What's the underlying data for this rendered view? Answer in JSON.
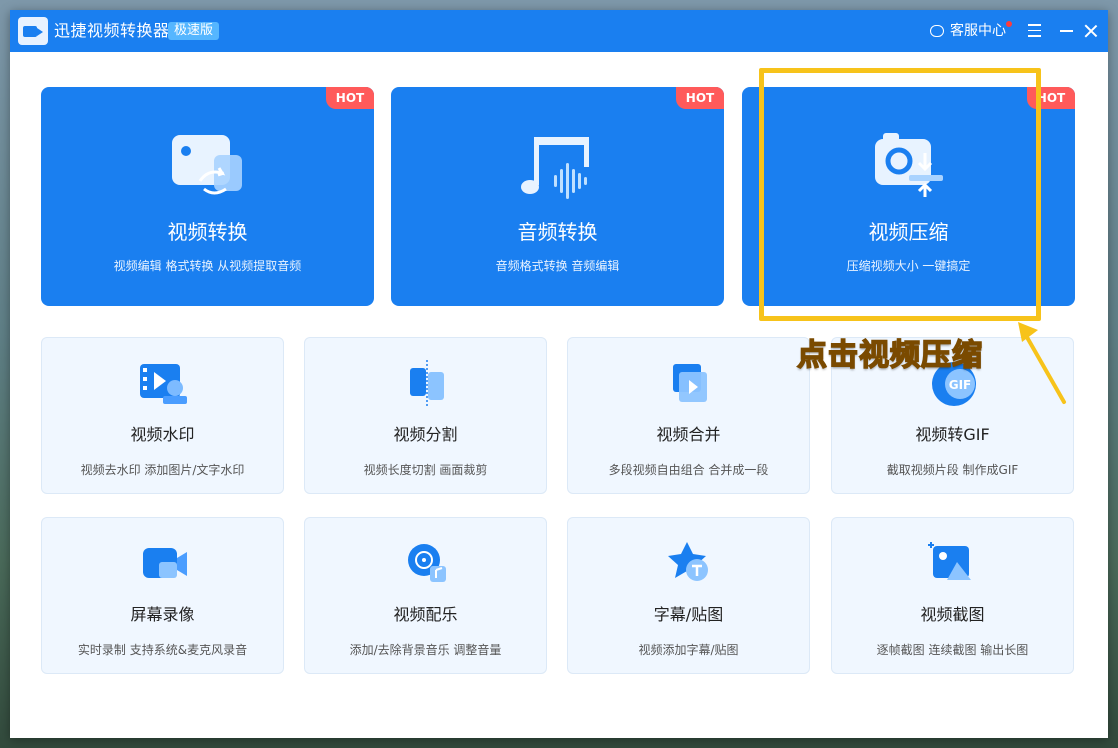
{
  "window": {
    "title": "迅捷视频转换器",
    "edition": "极速版",
    "support_label": "客服中心"
  },
  "featured": [
    {
      "title": "视频转换",
      "desc": "视频编辑 格式转换 从视频提取音频",
      "badge": "HOT",
      "icon": "video-convert-icon"
    },
    {
      "title": "音频转换",
      "desc": "音频格式转换 音频编辑",
      "badge": "HOT",
      "icon": "audio-convert-icon"
    },
    {
      "title": "视频压缩",
      "desc": "压缩视频大小 一键搞定",
      "badge": "HOT",
      "icon": "video-compress-icon"
    }
  ],
  "tools": [
    {
      "title": "视频水印",
      "desc": "视频去水印 添加图片/文字水印",
      "icon": "watermark-icon"
    },
    {
      "title": "视频分割",
      "desc": "视频长度切割 画面裁剪",
      "icon": "split-icon"
    },
    {
      "title": "视频合并",
      "desc": "多段视频自由组合 合并成一段",
      "icon": "merge-icon"
    },
    {
      "title": "视频转GIF",
      "desc": "截取视频片段 制作成GIF",
      "icon": "gif-icon",
      "icon_text": "GIF"
    },
    {
      "title": "屏幕录像",
      "desc": "实时录制 支持系统&麦克风录音",
      "icon": "screen-record-icon"
    },
    {
      "title": "视频配乐",
      "desc": "添加/去除背景音乐 调整音量",
      "icon": "music-icon"
    },
    {
      "title": "字幕/贴图",
      "desc": "视频添加字幕/贴图",
      "icon": "subtitle-icon"
    },
    {
      "title": "视频截图",
      "desc": "逐帧截图 连续截图 输出长图",
      "icon": "screenshot-icon"
    }
  ],
  "annotation": {
    "callout_text": "点击视频压缩",
    "color": "#f7c31a"
  },
  "colors": {
    "brand": "#1a7ff0",
    "hot_badge": "#ff5a5a",
    "card_bg": "#f0f7ff"
  }
}
